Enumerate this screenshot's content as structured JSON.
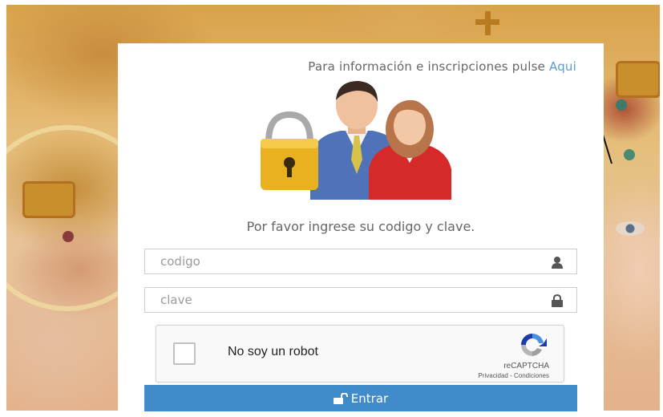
{
  "info": {
    "text": "Para información e inscripciones pulse",
    "link_label": "Aqui"
  },
  "login": {
    "prompt": "Por favor ingrese su codigo y clave.",
    "codigo_placeholder": "codigo",
    "clave_placeholder": "clave",
    "codigo_value": "",
    "clave_value": "",
    "submit_label": "Entrar"
  },
  "captcha": {
    "label": "No soy un robot",
    "brand": "reCAPTCHA",
    "links": "Privacidad - Condiciones"
  },
  "icons": {
    "user_field": "user-icon",
    "password_field": "lock-icon",
    "submit": "unlock-icon",
    "illustration": "users-lock-icon",
    "captcha": "recaptcha-icon"
  },
  "colors": {
    "button": "#428bca",
    "link": "#5b9bd1"
  }
}
